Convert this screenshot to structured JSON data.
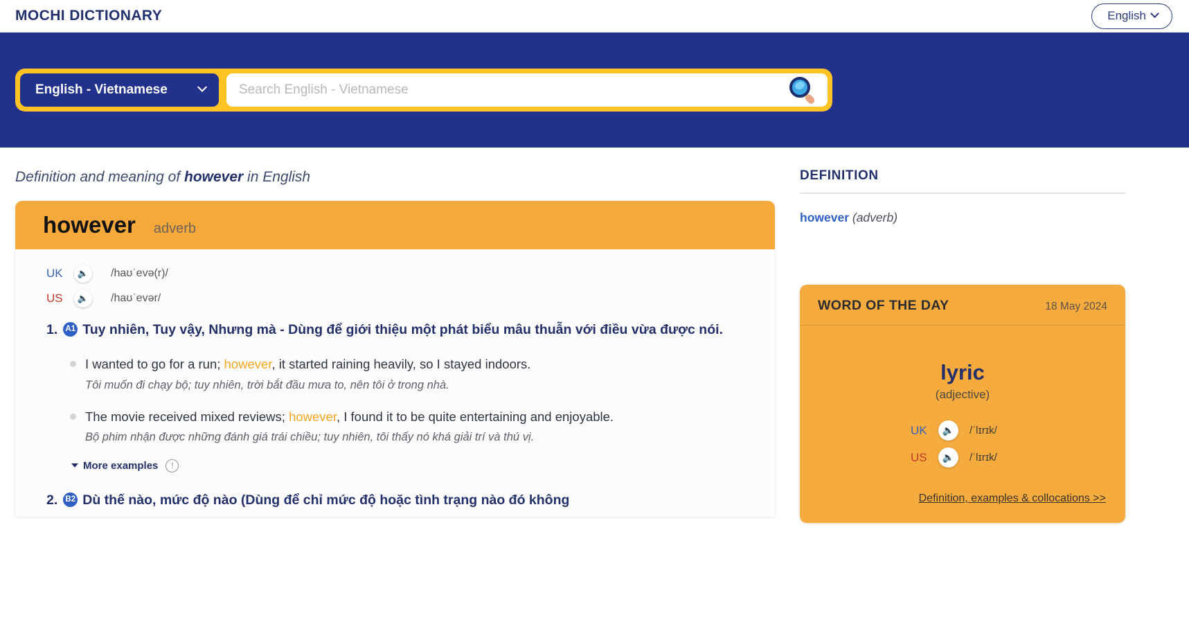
{
  "header": {
    "logo": "MOCHI DICTIONARY",
    "language_button": "English",
    "chevron_icon": "chevron-down-icon"
  },
  "search": {
    "pair_selected": "English - Vietnamese",
    "placeholder": "Search English - Vietnamese",
    "value": "",
    "search_icon": "magnifier-icon"
  },
  "page": {
    "subtitle_prefix": "Definition and meaning of ",
    "subtitle_word": "however",
    "subtitle_suffix": " in English"
  },
  "word_card": {
    "word": "however",
    "pos": "adverb",
    "pronunciations": [
      {
        "region": "UK",
        "ipa": "/haʊˈevə(r)/",
        "icon": "speaker-icon"
      },
      {
        "region": "US",
        "ipa": "/haʊˈevər/",
        "icon": "speaker-icon"
      }
    ],
    "senses": [
      {
        "number": "1.",
        "cefr": "A1",
        "text": "Tuy nhiên, Tuy vậy, Nhưng mà - Dùng để giới thiệu một phát biểu mâu thuẫn với điều vừa được nói.",
        "examples": [
          {
            "en_before": "I wanted to go for a run; ",
            "en_highlight": "however",
            "en_after": ", it started raining heavily, so I stayed indoors.",
            "vi": "Tôi muốn đi chạy bộ; tuy nhiên, trời bắt đầu mưa to, nên tôi ở trong nhà."
          },
          {
            "en_before": "The movie received mixed reviews; ",
            "en_highlight": "however",
            "en_after": ", I found it to be quite entertaining and enjoyable.",
            "vi": "Bộ phim nhận được những đánh giá trái chiều; tuy nhiên, tôi thấy nó khá giải trí và thú vị."
          }
        ],
        "more_examples_label": "More examples",
        "info_icon": "info-icon"
      },
      {
        "number": "2.",
        "cefr": "B2",
        "text": "Dù thế nào, mức độ nào (Dùng để chỉ mức độ hoặc tình trạng nào đó không"
      }
    ]
  },
  "sidebar": {
    "definition_title": "DEFINITION",
    "definition_word": "however",
    "definition_pos": "(adverb)",
    "word_of_the_day": {
      "title": "WORD OF THE DAY",
      "date": "18 May 2024",
      "word": "lyric",
      "pos": "(adjective)",
      "pronunciations": [
        {
          "region": "UK",
          "ipa": "/ˈlɪrɪk/",
          "icon": "speaker-icon"
        },
        {
          "region": "US",
          "ipa": "/ˈlɪrɪk/",
          "icon": "speaker-icon"
        }
      ],
      "link": "Definition, examples & collocations >>"
    }
  },
  "colors": {
    "brand_navy": "#22318c",
    "brand_yellow": "#ffc423",
    "accent_orange": "#f6a93b",
    "uk_blue": "#2f5fc4",
    "us_red": "#c0392b"
  }
}
